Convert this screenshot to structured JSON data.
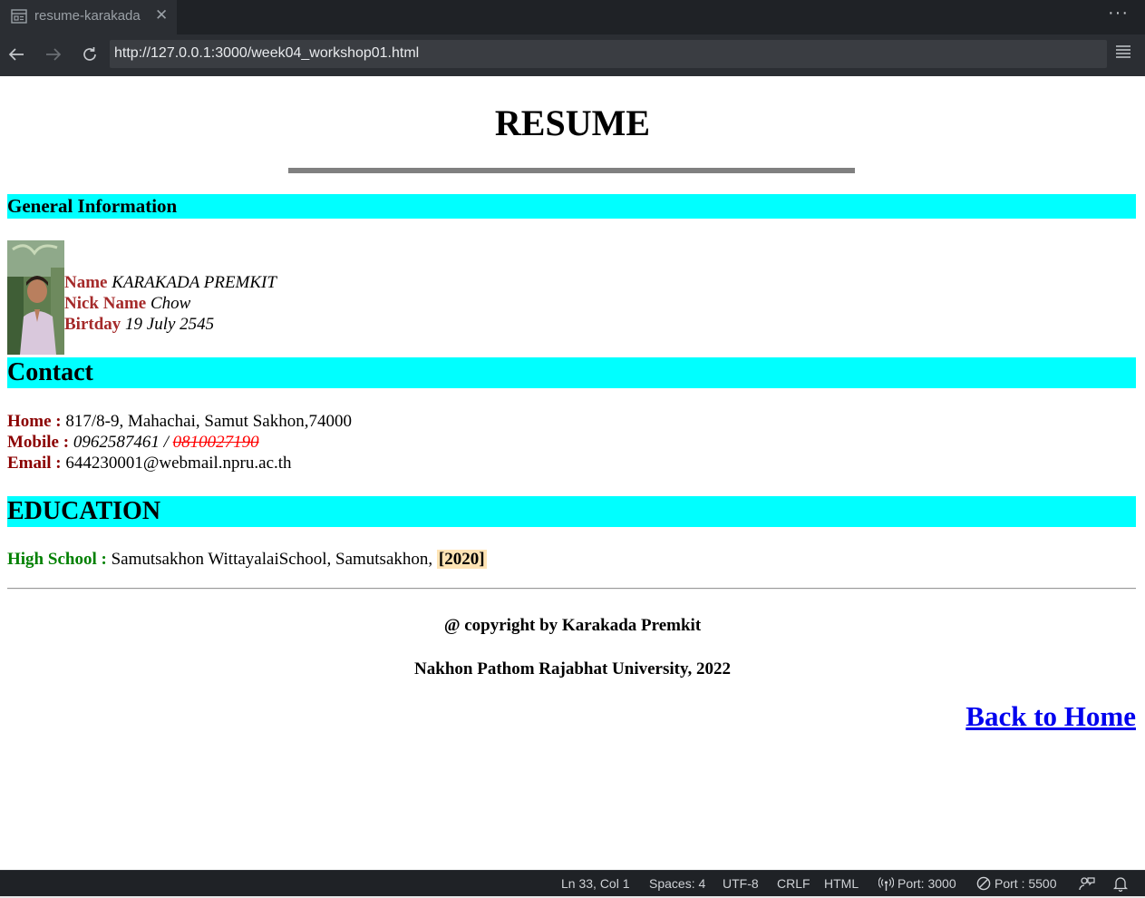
{
  "tab": {
    "title": "resume-karakada"
  },
  "navbar": {
    "url": "http://127.0.0.1:3000/week04_workshop01.html"
  },
  "page": {
    "title": "RESUME",
    "general": {
      "heading": "General Information",
      "name_label": "Name",
      "name_value": "KARAKADA PREMKIT",
      "nick_label": "Nick Name",
      "nick_value": "Chow",
      "birth_label": "Birtday",
      "birth_value": "19 July 2545"
    },
    "contact": {
      "heading": "Contact",
      "home_label": "Home :",
      "home_value": "817/8-9, Mahachai, Samut Sakhon,74000",
      "mobile_label": "Mobile :",
      "mobile_value": "0962587461",
      "mobile_sep": " / ",
      "mobile_old": "0810027190",
      "email_label": "Email :",
      "email_value": "644230001@webmail.npru.ac.th"
    },
    "education": {
      "heading": "EDUCATION",
      "school_label": "High School :",
      "school_value": "Samutsakhon WittayalaiSchool, Samutsakhon,",
      "school_year": "[2020]"
    },
    "footer": {
      "copyright": "@ copyright by Karakada Premkit",
      "university": "Nakhon Pathom Rajabhat University, 2022",
      "back_link": "Back to Home"
    }
  },
  "statusbar": {
    "position": "Ln 33, Col 1",
    "spaces": "Spaces: 4",
    "encoding": "UTF-8",
    "eol": "CRLF",
    "language": "HTML",
    "port1": "Port: 3000",
    "port2": "Port : 5500"
  },
  "colors": {
    "section_bg": "#00ffff",
    "label_brown": "#a52a2a",
    "label_dark_red": "#8b0000",
    "label_green": "#008000",
    "link_blue": "#0000ee",
    "year_highlight": "#ffe4b5",
    "old_number_red": "#ff0000"
  },
  "icons": [
    "preview-icon",
    "close-icon",
    "more-icon",
    "back-arrow-icon",
    "forward-arrow-icon",
    "reload-icon",
    "menu-icon",
    "broadcast-icon",
    "no-entry-icon",
    "feedback-icon",
    "bell-icon"
  ]
}
